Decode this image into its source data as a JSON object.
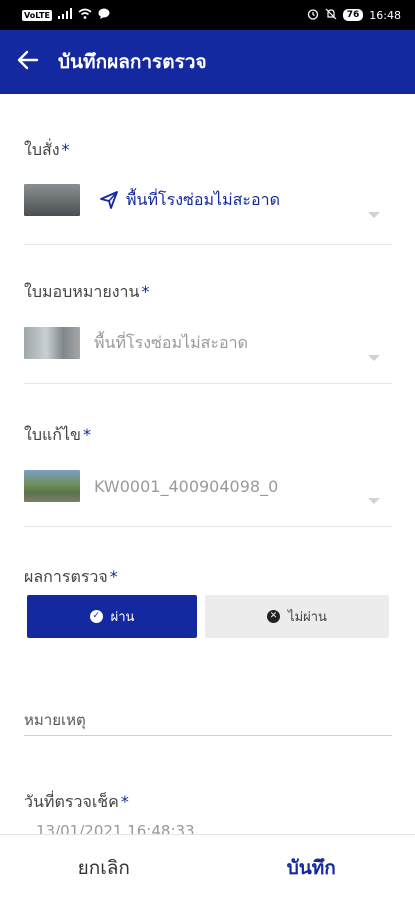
{
  "status_bar": {
    "network_badge": "VoLTE",
    "right_icons": [
      "alarm-icon",
      "mute-icon",
      "battery-icon"
    ],
    "battery": "76",
    "time": "16:48"
  },
  "app_bar": {
    "title": "บันทึกผลการตรวจ",
    "back_icon": "arrow-left-icon"
  },
  "form": {
    "order": {
      "label": "ใบสั่ง",
      "required_mark": "*",
      "value": "พื้นที่โรงซ่อมไม่สะอาด"
    },
    "assignment": {
      "label": "ใบมอบหมายงาน",
      "required_mark": "*",
      "value": "พื้นที่โรงซ่อมไม่สะอาด"
    },
    "correction": {
      "label": "ใบแก้ไข",
      "required_mark": "*",
      "value": "KW0001_400904098_0"
    },
    "result": {
      "label": "ผลการตรวจ",
      "required_mark": "*",
      "pass_label": "ผ่าน",
      "fail_label": "ไม่ผ่าน",
      "selected": "ผ่าน"
    },
    "remark": {
      "placeholder": "หมายเหตุ",
      "value": ""
    },
    "check_date": {
      "label": "วันที่ตรวจเช็ค",
      "required_mark": "*",
      "value": "13/01/2021 16:48:33"
    }
  },
  "bottom_bar": {
    "cancel_label": "ยกเลิก",
    "save_label": "บันทึก"
  },
  "colors": {
    "primary": "#1429a0",
    "status_bar": "#000000",
    "fail_button_bg": "#ececec"
  }
}
